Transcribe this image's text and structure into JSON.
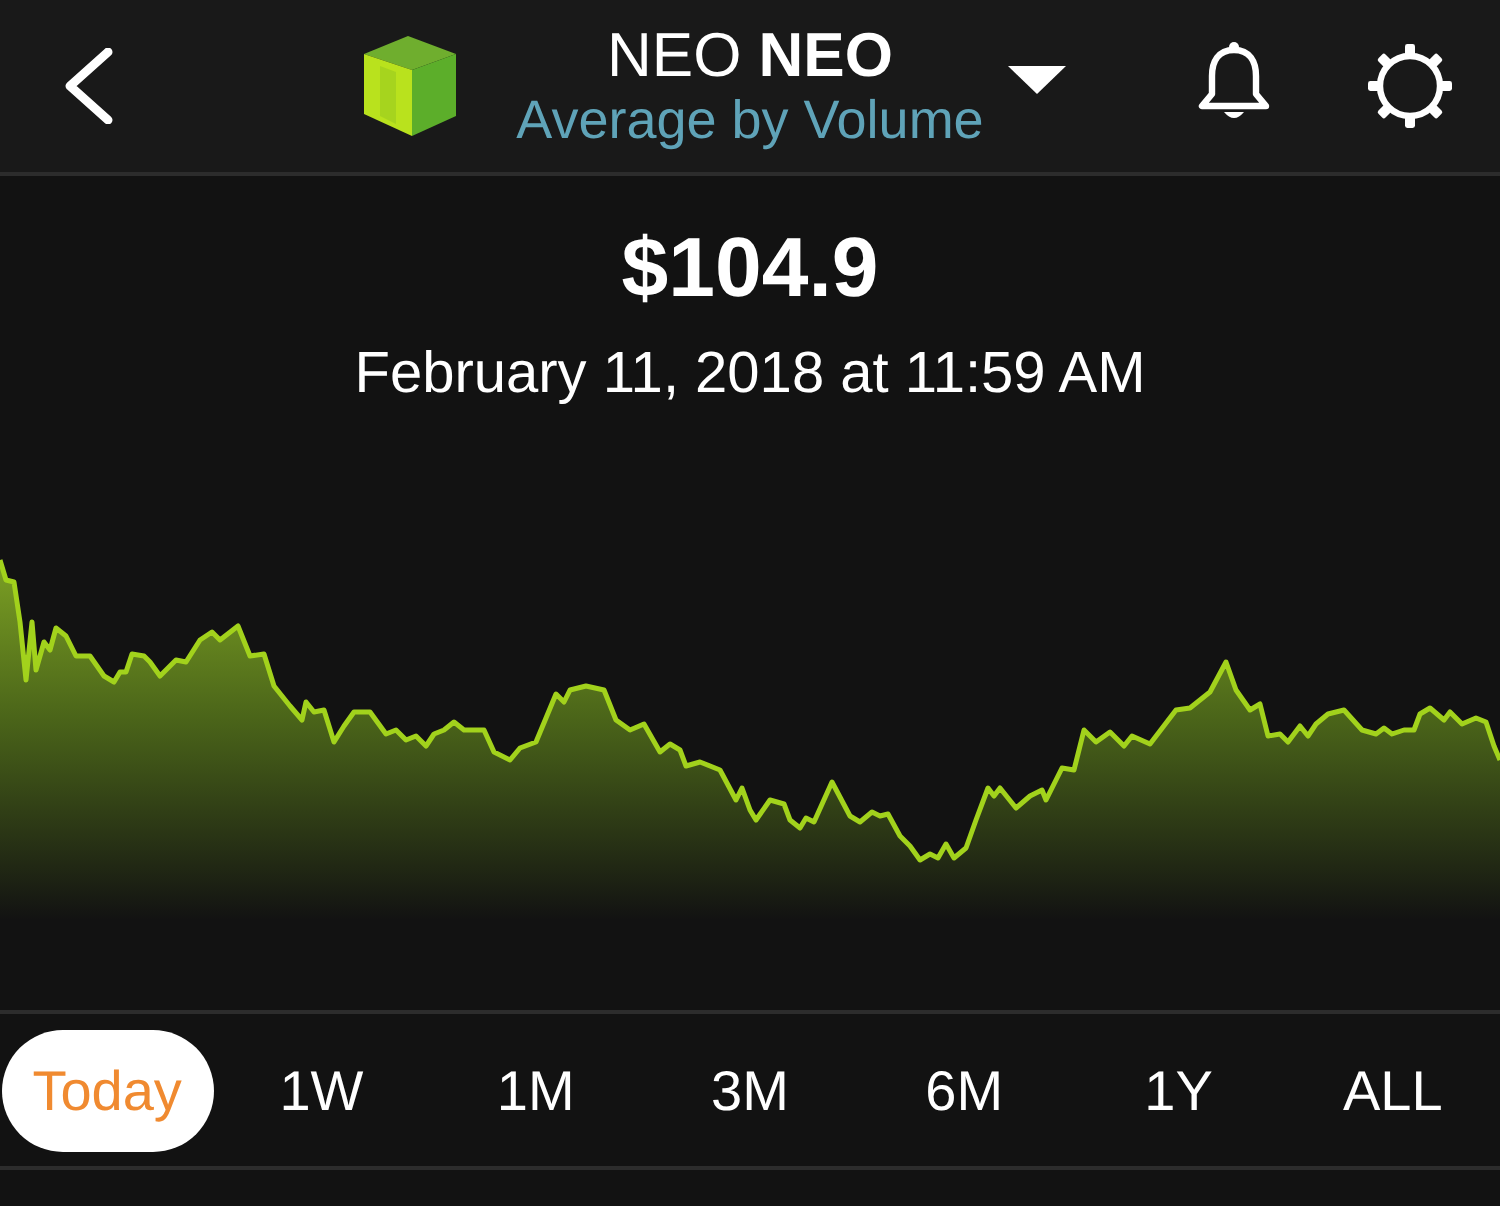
{
  "header": {
    "title": "NEO **NEO**",
    "subtitle": "Average by Volume"
  },
  "price": {
    "value": "$104.9",
    "timestamp": "February 11, 2018 at 11:59 AM"
  },
  "ranges": [
    {
      "label": "Today",
      "selected": true
    },
    {
      "label": "1W",
      "selected": false
    },
    {
      "label": "1M",
      "selected": false
    },
    {
      "label": "3M",
      "selected": false
    },
    {
      "label": "6M",
      "selected": false
    },
    {
      "label": "1Y",
      "selected": false
    },
    {
      "label": "ALL",
      "selected": false
    }
  ]
}
